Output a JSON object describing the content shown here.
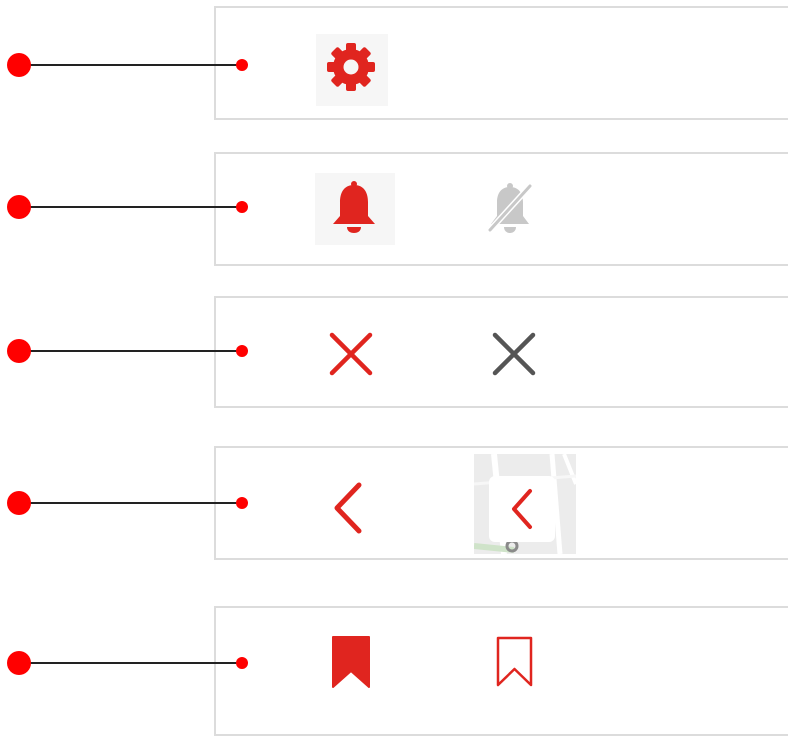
{
  "colors": {
    "accent": "#e0251f",
    "marker": "#ff0000",
    "muted": "#c8c8c8",
    "dark": "#555555",
    "panel_border": "#dcdcdc"
  },
  "rows": [
    {
      "id": "settings",
      "icons": [
        "gear-icon"
      ]
    },
    {
      "id": "notifications",
      "icons": [
        "bell-icon",
        "bell-muted-icon"
      ]
    },
    {
      "id": "close",
      "icons": [
        "close-icon-red",
        "close-icon-gray"
      ]
    },
    {
      "id": "back",
      "icons": [
        "chevron-left-icon",
        "chevron-left-map-button"
      ]
    },
    {
      "id": "bookmark",
      "icons": [
        "bookmark-filled-icon",
        "bookmark-outline-icon"
      ]
    }
  ]
}
